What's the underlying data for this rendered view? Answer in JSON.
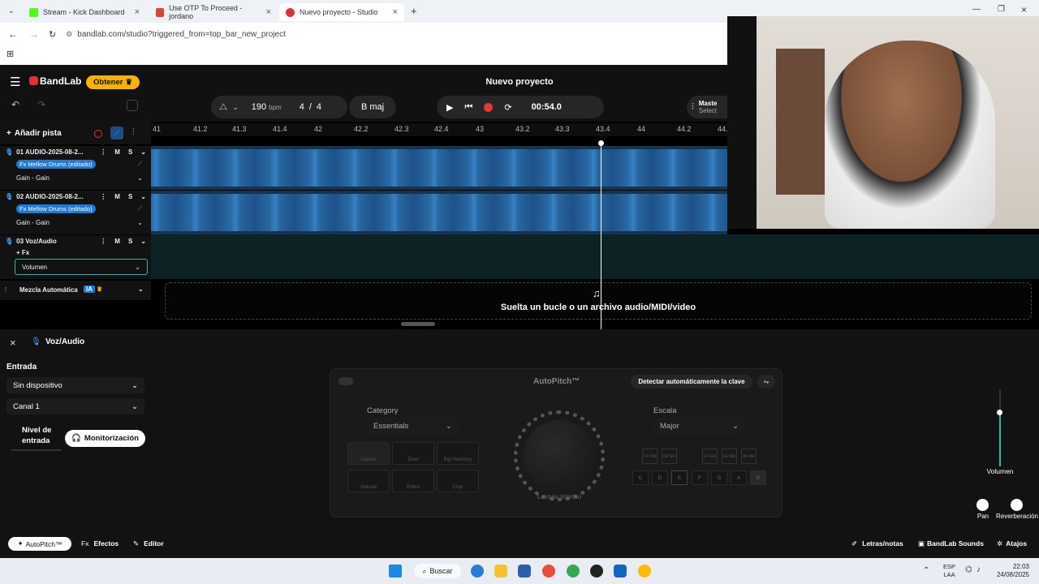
{
  "browser": {
    "tabs": [
      {
        "label": "Stream - Kick Dashboard",
        "color": "#53fc18"
      },
      {
        "label": "Use OTP To Proceed - jordano",
        "color": "#d14836"
      },
      {
        "label": "Nuevo proyecto - Studio",
        "color": "#e22d3c"
      }
    ],
    "url": "bandlab.com/studio?triggered_from=top_bar_new_project"
  },
  "header": {
    "logo": "BandLab",
    "obtain_button": "Obtener",
    "project_title": "Nuevo proyecto",
    "master_label": "Maste",
    "master_sub": "Select"
  },
  "transport": {
    "bpm": "190",
    "bpm_unit": "bpm",
    "time_sig_num": "4",
    "time_sig_sep": "/",
    "time_sig_den": "4",
    "key": "B maj",
    "time": "00:54.0"
  },
  "toolbar": {
    "add_track": "Añadir pista"
  },
  "ruler": {
    "ticks": [
      "41",
      "41.2",
      "41.3",
      "41.4",
      "42",
      "42.2",
      "42.3",
      "42.4",
      "43",
      "43.2",
      "43.3",
      "43.4",
      "44",
      "44.2",
      "44."
    ]
  },
  "tracks": [
    {
      "name": "01  AUDIO-2025-08-2...",
      "fx": "Fx Mellow Drums (editado)",
      "param": "Gain - Gain",
      "m": "M",
      "s": "S"
    },
    {
      "name": "02  AUDIO-2025-08-2...",
      "fx": "Fx Mellow Drums (editado)",
      "param": "Gain - Gain",
      "m": "M",
      "s": "S"
    },
    {
      "name": "03  Voz/Audio",
      "fx": "+ Fx",
      "param": "Volumen",
      "m": "M",
      "s": "S"
    }
  ],
  "automix": {
    "label": "Mezcla Automática",
    "badge": "IA"
  },
  "drop_zone": "Suelta un bucle o un archivo audio/MIDI/video",
  "panel": {
    "track_title": "Voz/Audio",
    "input_heading": "Entrada",
    "device": "Sin dispositivo",
    "channel": "Canal 1",
    "input_level_line1": "Nivel de",
    "input_level_line2": "entrada",
    "monitor_button": "Monitorización",
    "autopitch": {
      "title": "AutoPitch™",
      "detect_button": "Detectar automáticamente la clave",
      "category_label": "Category",
      "category_value": "Essentials",
      "scale_label": "Escala",
      "scale_value": "Major",
      "styles": [
        "Classic",
        "Duet",
        "Big Harmony",
        "Natural",
        "Robot",
        "Chip"
      ],
      "knob_label": "Lo más intenso",
      "chords": [
        "C#\nDb",
        "D#\nEb",
        "F#\nGb",
        "G#\nAb",
        "A#\nBb"
      ],
      "keys": [
        "C",
        "D",
        "E",
        "F",
        "G",
        "A",
        "B"
      ]
    },
    "volume_label": "Volumen",
    "pan_label": "Pan",
    "reverb_label": "Reverberación"
  },
  "bottom_tabs": {
    "autopitch": "AutoPitch™",
    "effects": "Efectos",
    "effects_prefix": "Fx",
    "editor": "Editor",
    "lyrics": "Letras/notas",
    "sounds": "BandLab Sounds",
    "shortcuts": "Atajos"
  },
  "taskbar": {
    "search": "Buscar",
    "lang1": "ESP",
    "lang2": "LAA",
    "time": "22:03",
    "date": "24/08/2025"
  }
}
